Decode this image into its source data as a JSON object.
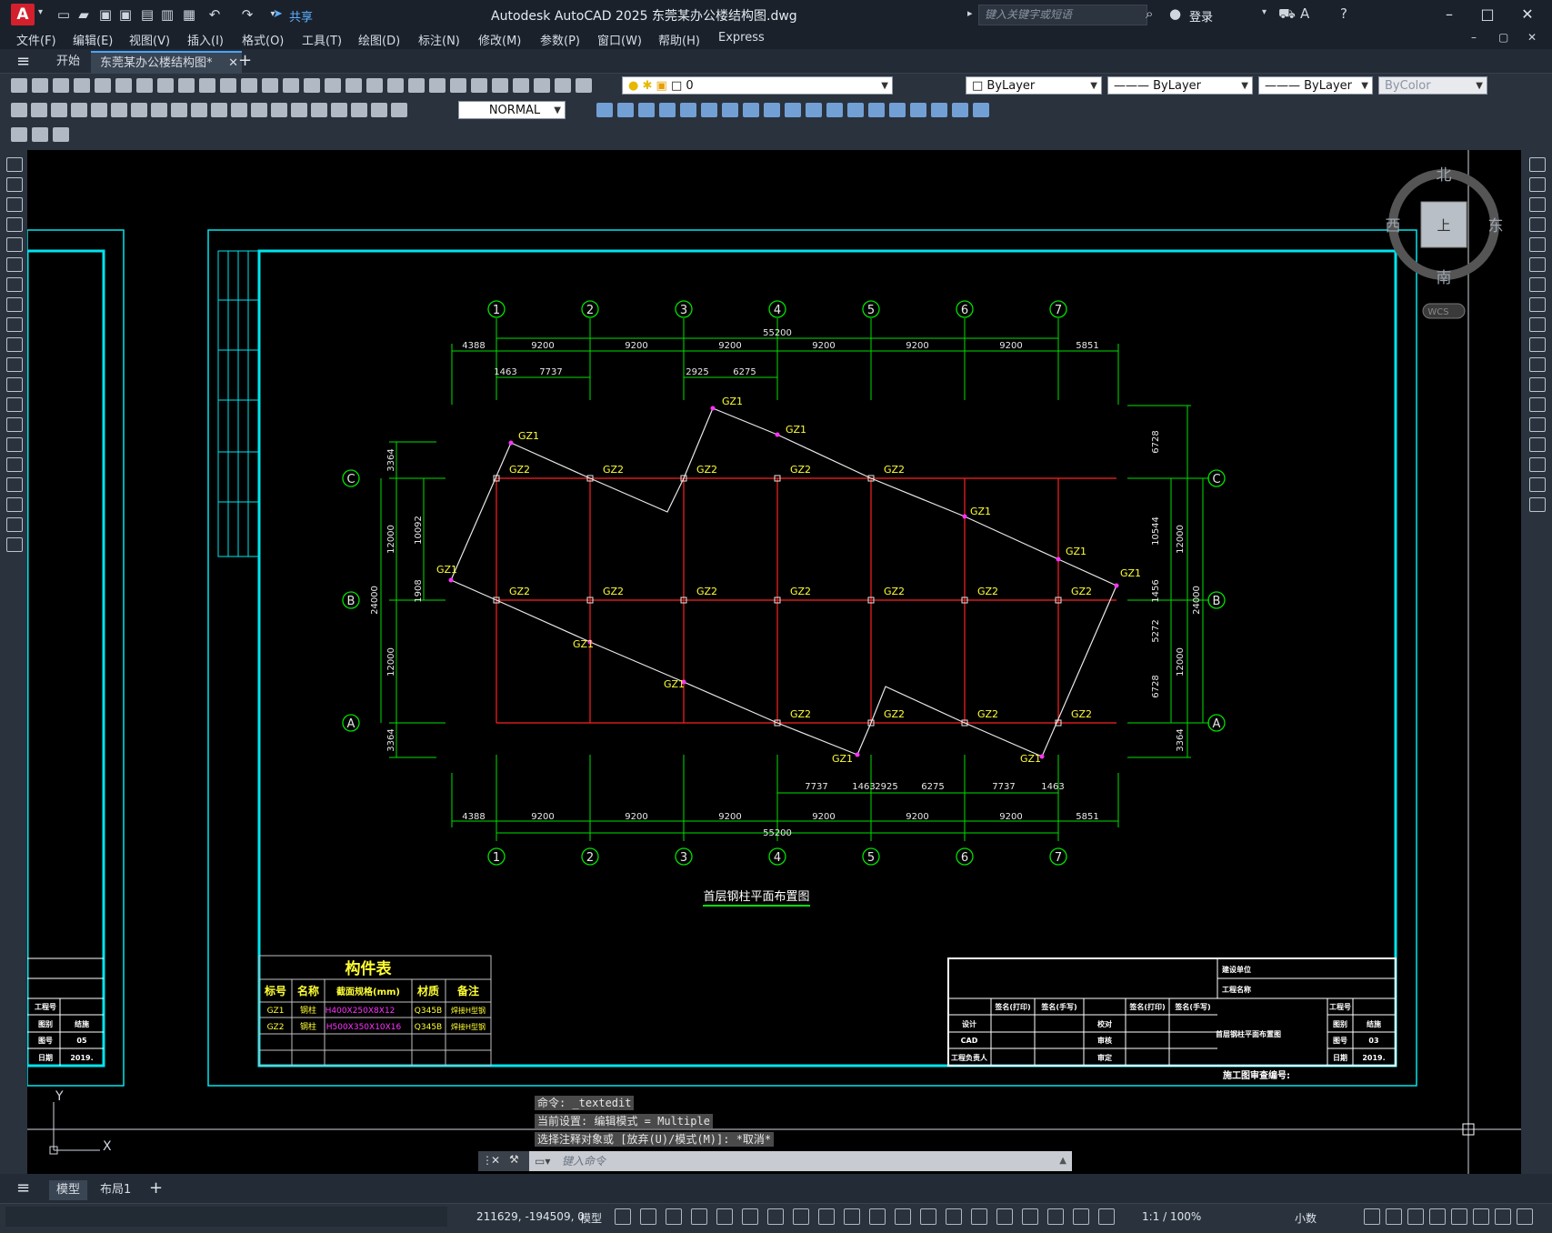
{
  "title_bar": {
    "app_title": "Autodesk AutoCAD 2025    东莞某办公楼结构图.dwg",
    "share_label": "共享",
    "search_placeholder": "键入关键字或短语",
    "login_label": "登录"
  },
  "menu": [
    "文件(F)",
    "编辑(E)",
    "视图(V)",
    "插入(I)",
    "格式(O)",
    "工具(T)",
    "绘图(D)",
    "标注(N)",
    "修改(M)",
    "参数(P)",
    "窗口(W)",
    "帮助(H)",
    "Express"
  ],
  "tabs": {
    "start": "开始",
    "drawing": "东莞某办公楼结构图*"
  },
  "toolbar": {
    "layer_value": "0",
    "color_value": "ByLayer",
    "linetype_value": "ByLayer",
    "lineweight_value": "ByLayer",
    "plotstyle_value": "ByColor",
    "dimstyle_value": "NORMAL"
  },
  "viewcube": {
    "north": "北",
    "south": "南",
    "east": "东",
    "west": "西",
    "top": "上",
    "wcs": "WCS"
  },
  "drawing": {
    "axis_cols": [
      "1",
      "2",
      "3",
      "4",
      "5",
      "6",
      "7"
    ],
    "axis_rows": [
      "C",
      "B",
      "A"
    ],
    "total_width": "55200",
    "top_dims": [
      "4388",
      "9200",
      "9200",
      "9200",
      "9200",
      "9200",
      "9200",
      "5851"
    ],
    "top_sub_dims": [
      "1463",
      "7737",
      "2925",
      "6275"
    ],
    "bottom_sub_dims": [
      "7737",
      "1463",
      "2925",
      "6275",
      "7737",
      "1463"
    ],
    "left_dims": [
      "3364",
      "12000",
      "12000",
      "3364"
    ],
    "left_total": "24000",
    "left_inner": [
      "10092",
      "1908"
    ],
    "right_dims": [
      "6728",
      "10544",
      "1456",
      "5272",
      "6728"
    ],
    "right_inner": [
      "12000",
      "12000"
    ],
    "right_total": "24000",
    "right_bottom": "3364",
    "plan_title": "首层钢柱平面布置图",
    "label_gz1": "GZ1",
    "label_gz2": "GZ2"
  },
  "member_table": {
    "title": "构件表",
    "headers": [
      "标号",
      "名称",
      "截面规格(mm)",
      "材质",
      "备注"
    ],
    "rows": [
      [
        "GZ1",
        "钢柱",
        "H400X250X8X12",
        "Q345B",
        "焊接H型钢"
      ],
      [
        "GZ2",
        "钢柱",
        "H500X350X10X16",
        "Q345B",
        "焊接H型钢"
      ]
    ]
  },
  "title_block": {
    "client": "建设单位",
    "project": "工程名称",
    "sig1": "签名(打印)",
    "sig2": "签名(手写)",
    "sig3": "签名(打印)",
    "sig4": "签名(手写)",
    "design": "设计",
    "cad": "CAD",
    "lead": "工程负责人",
    "check": "校对",
    "review": "审核",
    "approve": "审定",
    "drawing_name": "首层钢柱平面布置图",
    "proj_no": "工程号",
    "category": "图别",
    "category_val": "结施",
    "dwg_no": "图号",
    "dwg_no_val": "03",
    "date": "日期",
    "date_val": "2019.",
    "review_no": "施工图审查编号:"
  },
  "left_block": {
    "proj_no": "工程号",
    "category": "图别",
    "category_val": "结施",
    "dwg_no": "图号",
    "dwg_no_val": "05",
    "date": "日期",
    "date_val": "2019."
  },
  "command": {
    "hist1": "命令: _textedit",
    "hist2": "当前设置: 编辑模式 = Multiple",
    "hist3": "选择注释对象或 [放弃(U)/模式(M)]: *取消*",
    "placeholder": "键入命令"
  },
  "layout_tabs": {
    "model": "模型",
    "layout1": "布局1"
  },
  "status": {
    "coords": "211629, -194509, 0",
    "model": "模型",
    "scale": "1:1 / 100%",
    "units": "小数"
  }
}
